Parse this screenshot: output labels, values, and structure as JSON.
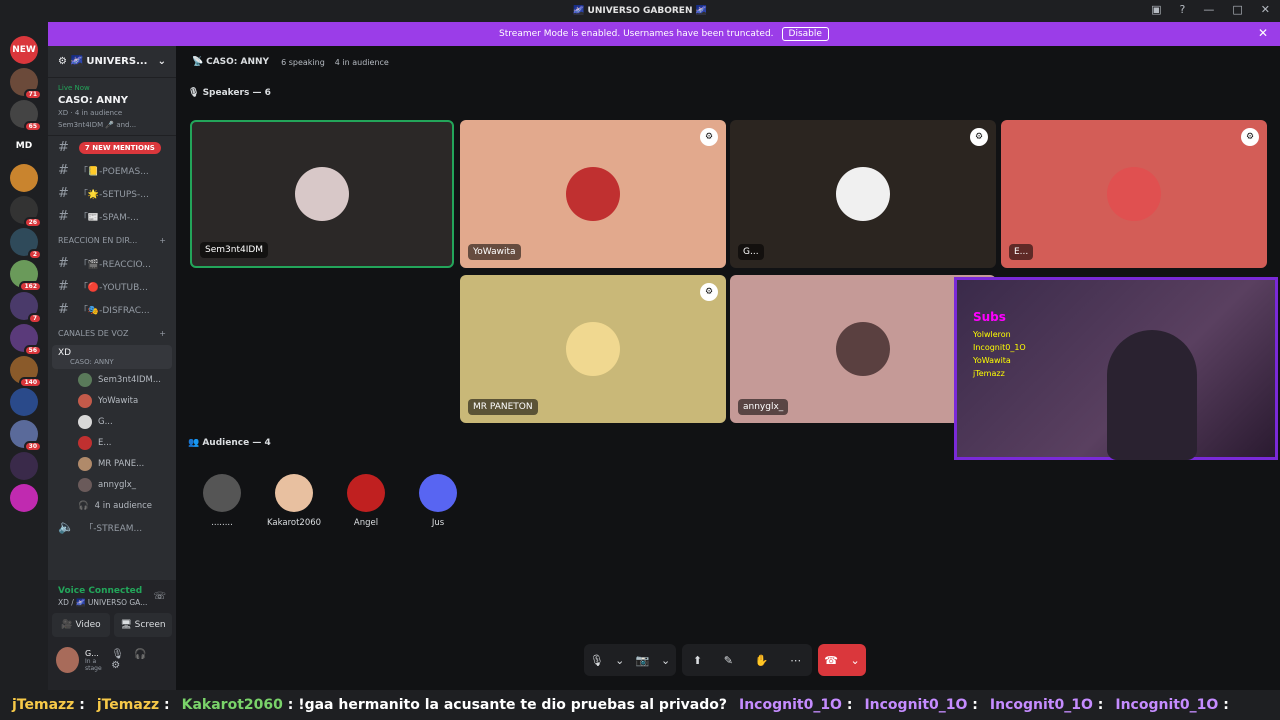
{
  "window": {
    "title": "🌌 UNIVERSO GABOREN 🌌"
  },
  "banner": {
    "text": "Streamer Mode is enabled. Usernames have been truncated.",
    "disable": "Disable"
  },
  "guilds": [
    {
      "label": "NEW",
      "color": "#da373c"
    },
    {
      "badge": "71",
      "color": "#6b4a3a"
    },
    {
      "badge": "65",
      "color": "#444"
    },
    {
      "label": "MD",
      "color": "#1e1f22"
    },
    {
      "color": "#c9842e"
    },
    {
      "badge": "26",
      "color": "#333"
    },
    {
      "badge": "2",
      "color": "#2f4a5a"
    },
    {
      "badge": "162",
      "color": "#6a9a5a"
    },
    {
      "badge": "7",
      "color": "#4a3a6a"
    },
    {
      "badge": "56",
      "color": "#5a3a7a"
    },
    {
      "badge": "140",
      "color": "#8a5a2a"
    },
    {
      "color": "#2a4a8a"
    },
    {
      "badge": "30",
      "color": "#5a6a9a"
    },
    {
      "color": "#3a2a4a"
    },
    {
      "color": "#c02ab0"
    }
  ],
  "sidebar": {
    "server": "🌌 UNIVERS...",
    "event": {
      "live": "Live Now",
      "title": "CASO: ANNY",
      "meta": "XD · 4 in audience",
      "speakers": "Sem3nt4IDM 🎤 and..."
    },
    "mentions": "7 NEW MENTIONS",
    "channels": [
      "「📒-POEMAS...",
      "「🌟-SETUPS-...",
      "「📰-SPAM-..."
    ],
    "cat1": "REACCION EN DIR...",
    "channels2": [
      "「🎬-REACCIO...",
      "「🔴-YOUTUB...",
      "「🎭-DISFRAC..."
    ],
    "cat2": "CANALES DE VOZ",
    "voice": {
      "name": "XD",
      "sub": "CASO: ANNY"
    },
    "voice_users": [
      "Sem3nt4IDM...",
      "YoWawita",
      "G...",
      "E...",
      "MR PANE...",
      "annyglx_"
    ],
    "audience": "4 in audience",
    "stream": "「-STREAM..."
  },
  "panel": {
    "connected": "Voice Connected",
    "where": "XD / 🌌 UNIVERSO GA...",
    "video": "Video",
    "screen": "Screen",
    "user": "G...",
    "status": "In a stage"
  },
  "main": {
    "title": "CASO: ANNY",
    "speaking": "6 speaking",
    "audience": "4 in audience",
    "speakers_label": "Speakers — 6",
    "audience_label": "Audience — 4"
  },
  "speakers": [
    "Sem3nt4IDM",
    "YoWawita",
    "G...",
    "E...",
    "MR PANETON",
    "annyglx_"
  ],
  "audience": [
    "........",
    "Kakarot2060",
    "Angel",
    "Jus"
  ],
  "cam": {
    "overlay": "Subs",
    "names": "Yolwleron Incognit0_1O YoWawita jTemazz"
  },
  "ticker": [
    {
      "user": "jTemazz",
      "color": "#f7c948",
      "text": " :"
    },
    {
      "user": "jTemazz",
      "color": "#f7c948",
      "text": " :"
    },
    {
      "user": "Kakarot2060",
      "color": "#7ad36a",
      "text": " : !gaa hermanito la acusante te dio pruebas al privado?"
    },
    {
      "user": "Incognit0_1O",
      "color": "#c58cff",
      "text": " :"
    },
    {
      "user": "Incognit0_1O",
      "color": "#c58cff",
      "text": " :"
    },
    {
      "user": "Incognit0_1O",
      "color": "#c58cff",
      "text": " :"
    },
    {
      "user": "Incognit0_1O",
      "color": "#c58cff",
      "text": " :"
    }
  ]
}
